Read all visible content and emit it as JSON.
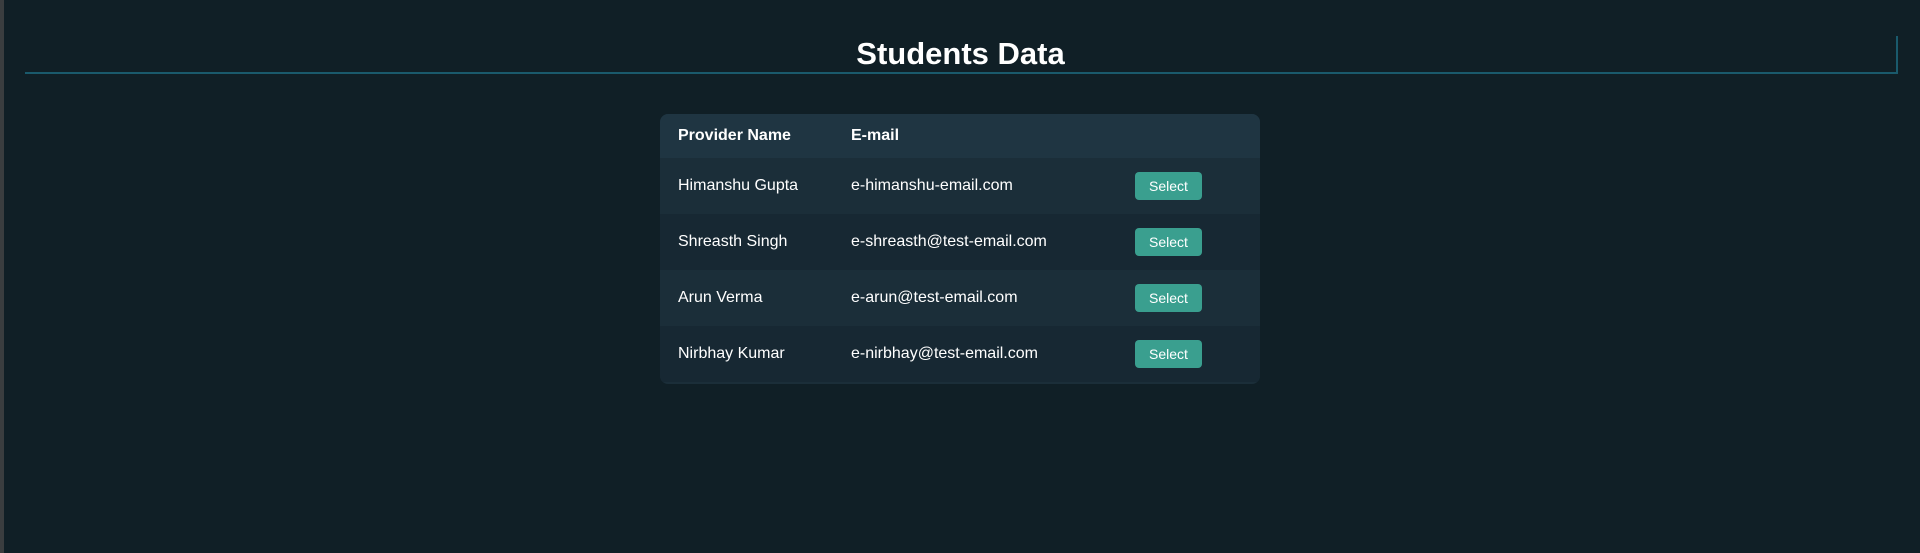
{
  "header": {
    "title": "Students Data"
  },
  "table": {
    "columns": [
      "Provider Name",
      "E-mail"
    ],
    "rows": [
      {
        "name": "Himanshu Gupta",
        "email": "e-himanshu-email.com",
        "action": "Select"
      },
      {
        "name": "Shreasth Singh",
        "email": "e-shreasth@test-email.com",
        "action": "Select"
      },
      {
        "name": "Arun Verma",
        "email": "e-arun@test-email.com",
        "action": "Select"
      },
      {
        "name": "Nirbhay Kumar",
        "email": "e-nirbhay@test-email.com",
        "action": "Select"
      }
    ]
  },
  "colors": {
    "background": "#101f26",
    "header_row": "#1f3542",
    "row_light": "#1b2e39",
    "row_dark": "#172833",
    "button": "#3a9f8f",
    "title_underline": "#1a5a6c"
  }
}
